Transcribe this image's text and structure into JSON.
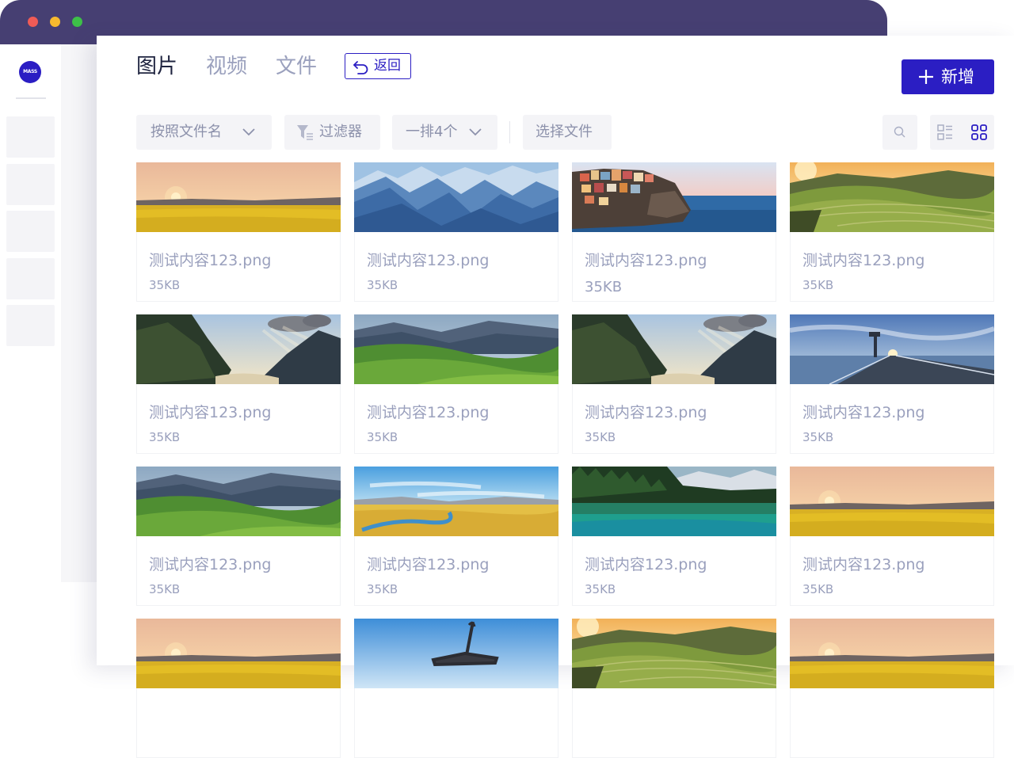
{
  "sidebar": {
    "logo_text": "MASS"
  },
  "tabs": [
    {
      "label": "图片",
      "active": true
    },
    {
      "label": "视频",
      "active": false
    },
    {
      "label": "文件",
      "active": false
    }
  ],
  "back_label": "返回",
  "add_label": "新增",
  "toolbar": {
    "sort_label": "按照文件名",
    "filter_label": "过滤器",
    "per_row_label": "一排4个",
    "select_label": "选择文件",
    "search_icon": "search-icon",
    "list_view_icon": "list-view-icon",
    "grid_view_icon": "grid-view-icon"
  },
  "colors": {
    "accent": "#2b1ec3",
    "titlebar": "#463f72",
    "muted_text": "#9aa0bd"
  },
  "files": [
    {
      "name": "测试内容123.png",
      "size": "35KB",
      "thumb": "sunset-field"
    },
    {
      "name": "测试内容123.png",
      "size": "35KB",
      "thumb": "blue-mountains"
    },
    {
      "name": "测试内容123.png",
      "size": "35KB",
      "thumb": "cliff-village"
    },
    {
      "name": "测试内容123.png",
      "size": "35KB",
      "thumb": "terraced-hills"
    },
    {
      "name": "测试内容123.png",
      "size": "35KB",
      "thumb": "fjord"
    },
    {
      "name": "测试内容123.png",
      "size": "35KB",
      "thumb": "green-valley"
    },
    {
      "name": "测试内容123.png",
      "size": "35KB",
      "thumb": "fjord"
    },
    {
      "name": "测试内容123.png",
      "size": "35KB",
      "thumb": "pier-sunset"
    },
    {
      "name": "测试内容123.png",
      "size": "35KB",
      "thumb": "green-valley"
    },
    {
      "name": "测试内容123.png",
      "size": "35KB",
      "thumb": "yellow-plain"
    },
    {
      "name": "测试内容123.png",
      "size": "35KB",
      "thumb": "lake-forest"
    },
    {
      "name": "测试内容123.png",
      "size": "35KB",
      "thumb": "sunset-field"
    },
    {
      "thumb": "sunset-field"
    },
    {
      "thumb": "airplane"
    },
    {
      "thumb": "terraced-hills"
    },
    {
      "thumb": "sunset-field"
    }
  ]
}
